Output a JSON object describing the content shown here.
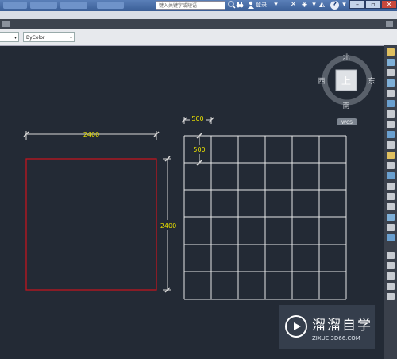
{
  "titlebar": {
    "search_placeholder": "键入关键字或短语",
    "login_label": "登录",
    "help_label": "?"
  },
  "properties": {
    "color_value": "ByColor"
  },
  "viewcube": {
    "north": "北",
    "south": "南",
    "east": "东",
    "west": "西",
    "face": "上",
    "wcs": "WCS"
  },
  "drawing": {
    "square_width_dim": "2400",
    "square_height_dim": "2400",
    "grid_cell_width_dim": "500",
    "grid_cell_height_dim": "500",
    "grid_columns": 6,
    "grid_rows": 6
  },
  "colors": {
    "background": "#232a35",
    "square_outline": "#c0141e",
    "grid_lines": "#e6e6e6",
    "dimension_text": "#e8e000"
  },
  "watermark": {
    "title": "溜溜自学",
    "url": "ZIXUE.3D66.COM"
  }
}
